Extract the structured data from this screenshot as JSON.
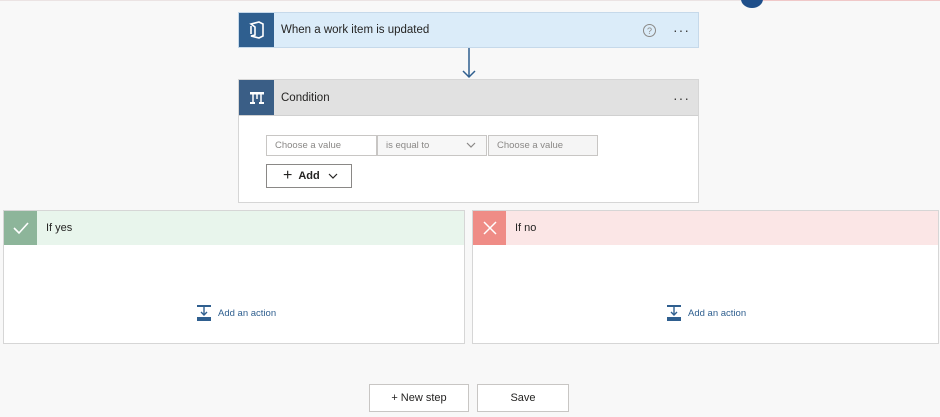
{
  "trigger": {
    "title": "When a work item is updated",
    "icon": "azure-devops-icon",
    "help_glyph": "?",
    "more_glyph": "···"
  },
  "condition": {
    "title": "Condition",
    "icon": "condition-icon",
    "more_glyph": "···",
    "left_placeholder": "Choose a value",
    "operator": "is equal to",
    "right_placeholder": "Choose a value",
    "add_label": "Add"
  },
  "branches": {
    "yes": {
      "title": "If yes",
      "add_action": "Add an action"
    },
    "no": {
      "title": "If no",
      "add_action": "Add an action"
    }
  },
  "footer": {
    "new_step_label": "+ New step",
    "save_label": "Save"
  },
  "colors": {
    "accent": "#2f5f8f",
    "yes": "#8db59a",
    "no": "#ef8c86"
  }
}
